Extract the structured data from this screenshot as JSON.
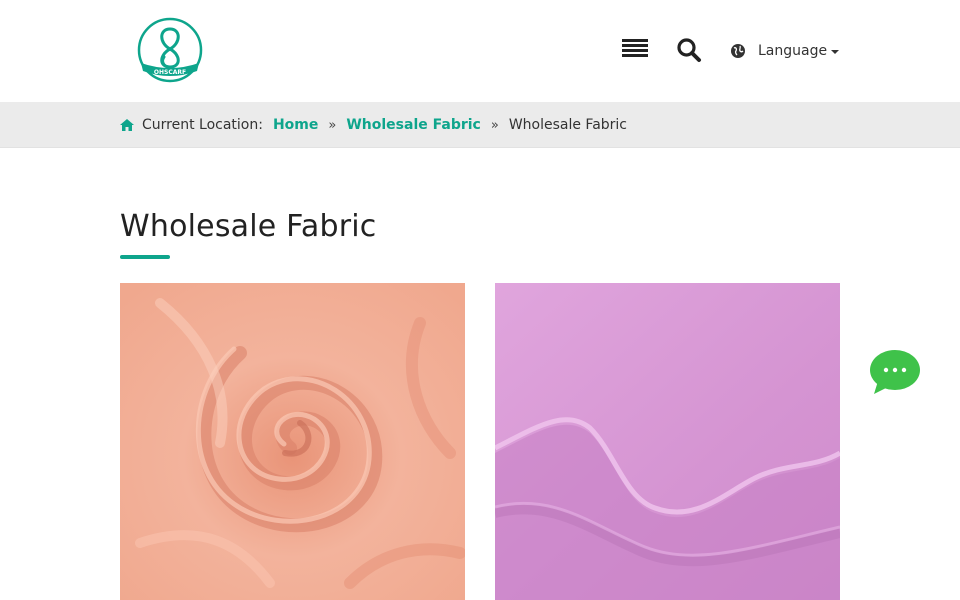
{
  "header": {
    "logo_text": "OHSCARF",
    "menu_icon": "list-icon",
    "search_icon": "search-icon",
    "language_icon": "globe-icon",
    "language_label": "Language"
  },
  "breadcrumb": {
    "home_icon": "home-icon",
    "location_label": "Current Location:",
    "items": [
      {
        "label": "Home"
      },
      {
        "label": "Wholesale Fabric"
      },
      {
        "label": "Wholesale Fabric"
      }
    ]
  },
  "page": {
    "title": "Wholesale Fabric"
  },
  "products": [
    {
      "image": "peach-linen-fabric-swirl",
      "color": "#f1a98f"
    },
    {
      "image": "lilac-linen-fabric-fold",
      "color": "#d99ad6"
    }
  ],
  "colors": {
    "accent": "#0ea58c",
    "chat": "#3fc24a"
  },
  "chat": {
    "icon": "chat-bubble-icon"
  }
}
